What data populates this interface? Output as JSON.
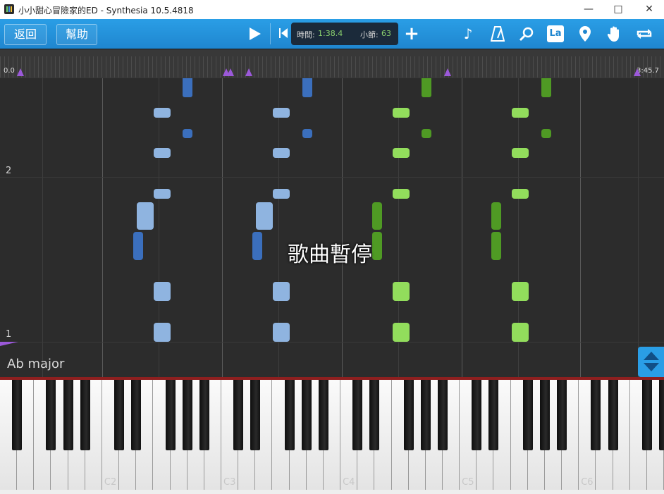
{
  "window": {
    "title": "小小甜心冒險家的ED - Synthesia 10.5.4818"
  },
  "toolbar": {
    "back_label": "返回",
    "help_label": "幫助",
    "time_label": "時間:",
    "time_value": "1:38.4",
    "measure_label": "小節:",
    "measure_value": "63",
    "add_label": "+",
    "la_label": "La",
    "icons": [
      "play-icon",
      "skip-to-start-icon",
      "add-icon",
      "note-icon",
      "metronome-icon",
      "magnifier-icon",
      "la-icon",
      "location-pin-icon",
      "hand-icon",
      "loop-icon"
    ]
  },
  "timeline": {
    "start": "0.0",
    "end": "3:45.7"
  },
  "notearea": {
    "paused_text": "歌曲暫停",
    "key_signature": "Ab major",
    "measure_numbers": [
      "2",
      "1"
    ]
  },
  "keyboard": {
    "c_labels": [
      "C2",
      "C3",
      "C4",
      "C5",
      "C6"
    ]
  },
  "colors": {
    "toolbar_blue": "#1f86cf",
    "left_hand_light": "#8fb4e0",
    "left_hand_dark": "#3b6fbd",
    "right_hand_light": "#92dd5c",
    "right_hand_dark": "#4f9a24",
    "marker_purple": "#9b59d9"
  }
}
